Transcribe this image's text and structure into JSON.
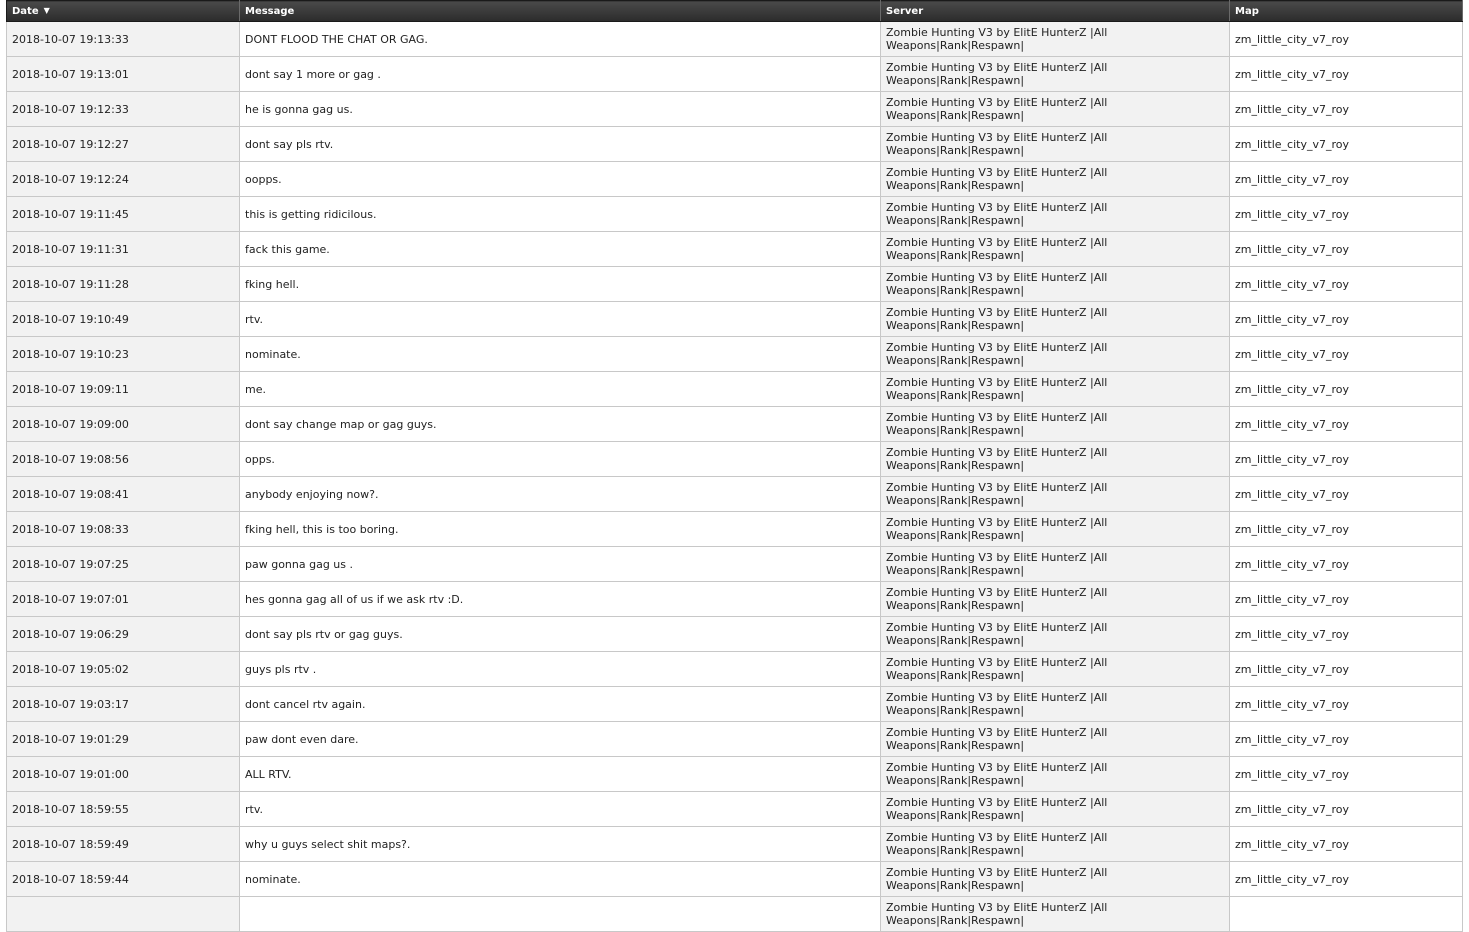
{
  "columns": {
    "date": "Date",
    "message": "Message",
    "server": "Server",
    "map": "Map"
  },
  "sort_indicator": "▼",
  "rows": [
    {
      "date": "2018-10-07 19:13:33",
      "message": "DONT FLOOD THE CHAT OR GAG.",
      "server": "Zombie Hunting V3 by ElitE HunterZ |All Weapons|Rank|Respawn|",
      "map": "zm_little_city_v7_roy"
    },
    {
      "date": "2018-10-07 19:13:01",
      "message": "dont say 1 more or gag .",
      "server": "Zombie Hunting V3 by ElitE HunterZ |All Weapons|Rank|Respawn|",
      "map": "zm_little_city_v7_roy"
    },
    {
      "date": "2018-10-07 19:12:33",
      "message": "he is gonna gag us.",
      "server": "Zombie Hunting V3 by ElitE HunterZ |All Weapons|Rank|Respawn|",
      "map": "zm_little_city_v7_roy"
    },
    {
      "date": "2018-10-07 19:12:27",
      "message": "dont say pls rtv.",
      "server": "Zombie Hunting V3 by ElitE HunterZ |All Weapons|Rank|Respawn|",
      "map": "zm_little_city_v7_roy"
    },
    {
      "date": "2018-10-07 19:12:24",
      "message": "oopps.",
      "server": "Zombie Hunting V3 by ElitE HunterZ |All Weapons|Rank|Respawn|",
      "map": "zm_little_city_v7_roy"
    },
    {
      "date": "2018-10-07 19:11:45",
      "message": "this is getting ridicilous.",
      "server": "Zombie Hunting V3 by ElitE HunterZ |All Weapons|Rank|Respawn|",
      "map": "zm_little_city_v7_roy"
    },
    {
      "date": "2018-10-07 19:11:31",
      "message": "fack this game.",
      "server": "Zombie Hunting V3 by ElitE HunterZ |All Weapons|Rank|Respawn|",
      "map": "zm_little_city_v7_roy"
    },
    {
      "date": "2018-10-07 19:11:28",
      "message": "fking hell.",
      "server": "Zombie Hunting V3 by ElitE HunterZ |All Weapons|Rank|Respawn|",
      "map": "zm_little_city_v7_roy"
    },
    {
      "date": "2018-10-07 19:10:49",
      "message": "rtv.",
      "server": "Zombie Hunting V3 by ElitE HunterZ |All Weapons|Rank|Respawn|",
      "map": "zm_little_city_v7_roy"
    },
    {
      "date": "2018-10-07 19:10:23",
      "message": "nominate.",
      "server": "Zombie Hunting V3 by ElitE HunterZ |All Weapons|Rank|Respawn|",
      "map": "zm_little_city_v7_roy"
    },
    {
      "date": "2018-10-07 19:09:11",
      "message": "me.",
      "server": "Zombie Hunting V3 by ElitE HunterZ |All Weapons|Rank|Respawn|",
      "map": "zm_little_city_v7_roy"
    },
    {
      "date": "2018-10-07 19:09:00",
      "message": "dont say change map or gag guys.",
      "server": "Zombie Hunting V3 by ElitE HunterZ |All Weapons|Rank|Respawn|",
      "map": "zm_little_city_v7_roy"
    },
    {
      "date": "2018-10-07 19:08:56",
      "message": "opps.",
      "server": "Zombie Hunting V3 by ElitE HunterZ |All Weapons|Rank|Respawn|",
      "map": "zm_little_city_v7_roy"
    },
    {
      "date": "2018-10-07 19:08:41",
      "message": "anybody enjoying now?.",
      "server": "Zombie Hunting V3 by ElitE HunterZ |All Weapons|Rank|Respawn|",
      "map": "zm_little_city_v7_roy"
    },
    {
      "date": "2018-10-07 19:08:33",
      "message": "fking hell, this is too boring.",
      "server": "Zombie Hunting V3 by ElitE HunterZ |All Weapons|Rank|Respawn|",
      "map": "zm_little_city_v7_roy"
    },
    {
      "date": "2018-10-07 19:07:25",
      "message": "paw gonna gag us .",
      "server": "Zombie Hunting V3 by ElitE HunterZ |All Weapons|Rank|Respawn|",
      "map": "zm_little_city_v7_roy"
    },
    {
      "date": "2018-10-07 19:07:01",
      "message": "hes gonna gag all of us if we ask rtv :D.",
      "server": "Zombie Hunting V3 by ElitE HunterZ |All Weapons|Rank|Respawn|",
      "map": "zm_little_city_v7_roy"
    },
    {
      "date": "2018-10-07 19:06:29",
      "message": "dont say pls rtv or gag guys.",
      "server": "Zombie Hunting V3 by ElitE HunterZ |All Weapons|Rank|Respawn|",
      "map": "zm_little_city_v7_roy"
    },
    {
      "date": "2018-10-07 19:05:02",
      "message": "guys pls rtv .",
      "server": "Zombie Hunting V3 by ElitE HunterZ |All Weapons|Rank|Respawn|",
      "map": "zm_little_city_v7_roy"
    },
    {
      "date": "2018-10-07 19:03:17",
      "message": "dont cancel rtv again.",
      "server": "Zombie Hunting V3 by ElitE HunterZ |All Weapons|Rank|Respawn|",
      "map": "zm_little_city_v7_roy"
    },
    {
      "date": "2018-10-07 19:01:29",
      "message": "paw dont even dare.",
      "server": "Zombie Hunting V3 by ElitE HunterZ |All Weapons|Rank|Respawn|",
      "map": "zm_little_city_v7_roy"
    },
    {
      "date": "2018-10-07 19:01:00",
      "message": "ALL RTV.",
      "server": "Zombie Hunting V3 by ElitE HunterZ |All Weapons|Rank|Respawn|",
      "map": "zm_little_city_v7_roy"
    },
    {
      "date": "2018-10-07 18:59:55",
      "message": "rtv.",
      "server": "Zombie Hunting V3 by ElitE HunterZ |All Weapons|Rank|Respawn|",
      "map": "zm_little_city_v7_roy"
    },
    {
      "date": "2018-10-07 18:59:49",
      "message": "why u guys select shit maps?.",
      "server": "Zombie Hunting V3 by ElitE HunterZ |All Weapons|Rank|Respawn|",
      "map": "zm_little_city_v7_roy"
    },
    {
      "date": "2018-10-07 18:59:44",
      "message": "nominate.",
      "server": "Zombie Hunting V3 by ElitE HunterZ |All Weapons|Rank|Respawn|",
      "map": "zm_little_city_v7_roy"
    },
    {
      "date": "",
      "message": "",
      "server": "Zombie Hunting V3 by ElitE HunterZ |All Weapons|Rank|Respawn|",
      "map": ""
    }
  ]
}
